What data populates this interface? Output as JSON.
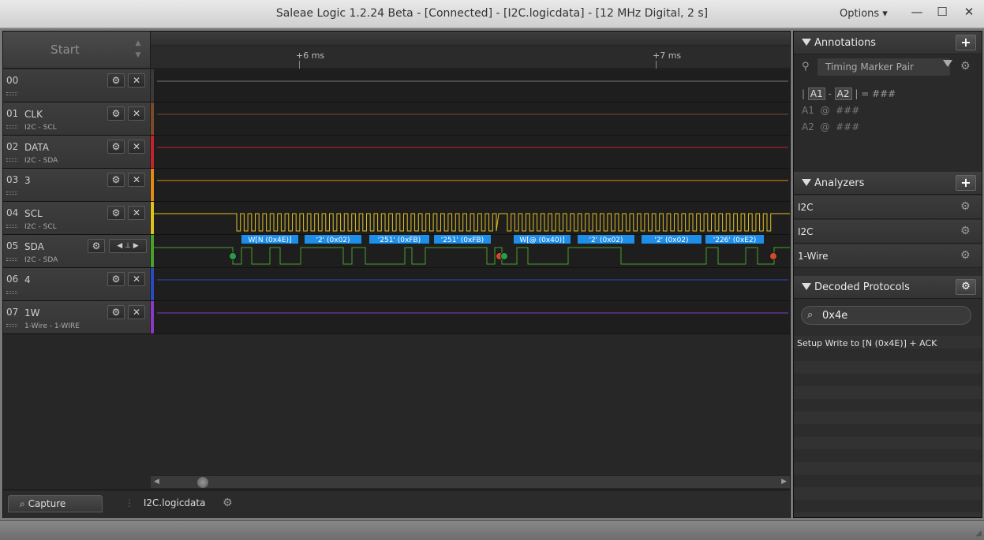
{
  "window": {
    "title": "Saleae Logic 1.2.24 Beta - [Connected] - [I2C.logicdata] - [12 MHz Digital, 2 s]",
    "options_label": "Options ▾",
    "minimize": "—",
    "maximize": "☐",
    "close": "✕"
  },
  "toolbar": {
    "start_label": "Start"
  },
  "ruler": {
    "ticks": [
      "+6 ms",
      "+7 ms"
    ]
  },
  "channels": [
    {
      "num": "00",
      "name": "",
      "sub": "",
      "color": "#3a3a3a"
    },
    {
      "num": "01",
      "name": "CLK",
      "sub": "I2C - SCL",
      "color": "#7a4a2a"
    },
    {
      "num": "02",
      "name": "DATA",
      "sub": "I2C - SDA",
      "color": "#c0242c"
    },
    {
      "num": "03",
      "name": "3",
      "sub": "",
      "color": "#e08a1c"
    },
    {
      "num": "04",
      "name": "SCL",
      "sub": "I2C - SCL",
      "color": "#e0c020"
    },
    {
      "num": "05",
      "name": "SDA",
      "sub": "I2C - SDA",
      "color": "#4aa02a"
    },
    {
      "num": "06",
      "name": "4",
      "sub": "",
      "color": "#2a4ac0"
    },
    {
      "num": "07",
      "name": "1W",
      "sub": "1-Wire - 1-WIRE",
      "color": "#8a3ac0"
    }
  ],
  "decoded_labels": [
    "W[N (0x4E)]",
    "'2' (0x02)",
    "'251' (0xFB)",
    "'251' (0xFB)",
    "W[@ (0x40)]",
    "'2' (0x02)",
    "'2' (0x02)",
    "'226' (0xE2)"
  ],
  "tabs": {
    "capture": "Capture",
    "file": "I2C.logicdata"
  },
  "annotations": {
    "title": "Annotations",
    "marker_select": "Timing Marker Pair",
    "line1_a1": "A1",
    "line1_a2": "A2",
    "line1_val": "= ###",
    "line2": "A1  @  ###",
    "line3": "A2  @  ###"
  },
  "analyzers": {
    "title": "Analyzers",
    "items": [
      "I2C",
      "I2C",
      "1-Wire"
    ]
  },
  "decoded_protocols": {
    "title": "Decoded Protocols",
    "search_value": "0x4e",
    "results": [
      "Setup Write to [N (0x4E)] + ACK"
    ]
  },
  "colors": {
    "label_blue": "#1e8fe8",
    "start_marker": "#2a9a4a",
    "stop_marker": "#d04a2a"
  }
}
